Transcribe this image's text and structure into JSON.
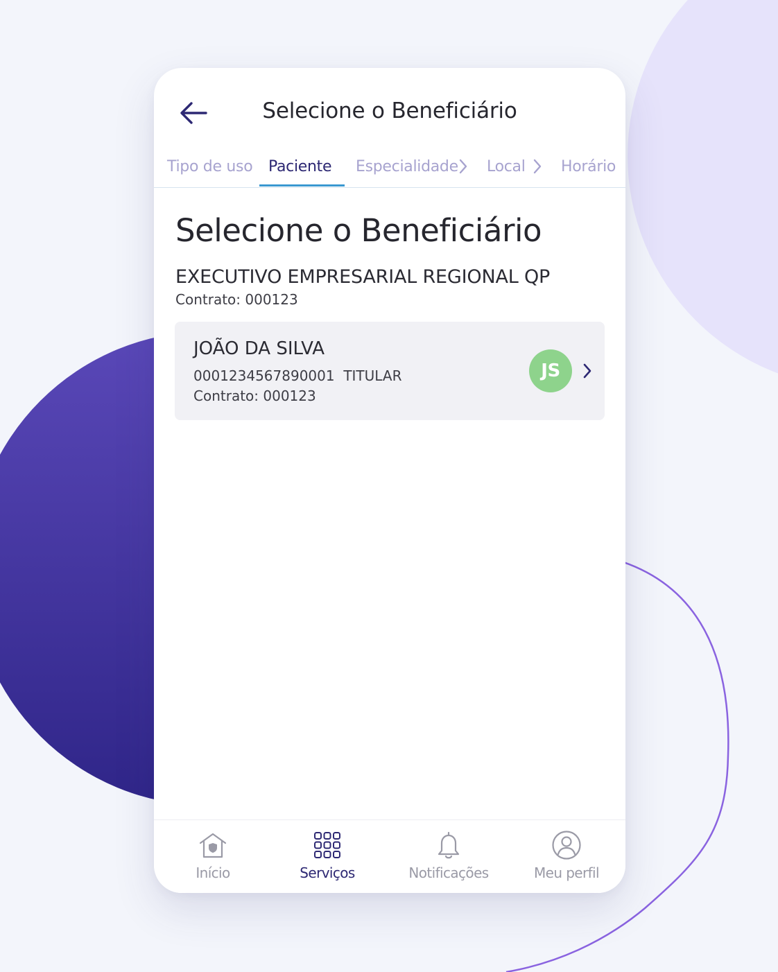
{
  "colors": {
    "background": "#f3f5fb",
    "accent_dark": "#2d2873",
    "tab_inactive": "#a7a3cf",
    "tab_indicator": "#3a98d1",
    "avatar_bg": "#8ed38c",
    "card_bg": "#f1f1f5",
    "decor_purple": "#4a3aa8",
    "decor_lavender": "#e6e3fb"
  },
  "header": {
    "back_icon": "arrow-left-icon",
    "title": "Selecione o Beneficiário"
  },
  "steps": [
    {
      "label": "Tipo de uso",
      "state": "done"
    },
    {
      "label": "Paciente",
      "state": "active"
    },
    {
      "label": "Especialidade",
      "state": "pending"
    },
    {
      "label": "Local",
      "state": "pending"
    },
    {
      "label": "Horário",
      "state": "pending"
    }
  ],
  "main": {
    "title": "Selecione o Beneficiário",
    "plan_name": "EXECUTIVO EMPRESARIAL REGIONAL QP",
    "plan_contract": "Contrato: 000123",
    "beneficiaries": [
      {
        "name": "JOÃO DA SILVA",
        "card_number": "0001234567890001",
        "role": "TITULAR",
        "contract": "Contrato: 000123",
        "initials": "JS"
      }
    ]
  },
  "nav": [
    {
      "label": "Início",
      "icon": "home-icon",
      "active": false
    },
    {
      "label": "Serviços",
      "icon": "grid-icon",
      "active": true
    },
    {
      "label": "Notificações",
      "icon": "bell-icon",
      "active": false
    },
    {
      "label": "Meu perfil",
      "icon": "profile-icon",
      "active": false
    }
  ]
}
